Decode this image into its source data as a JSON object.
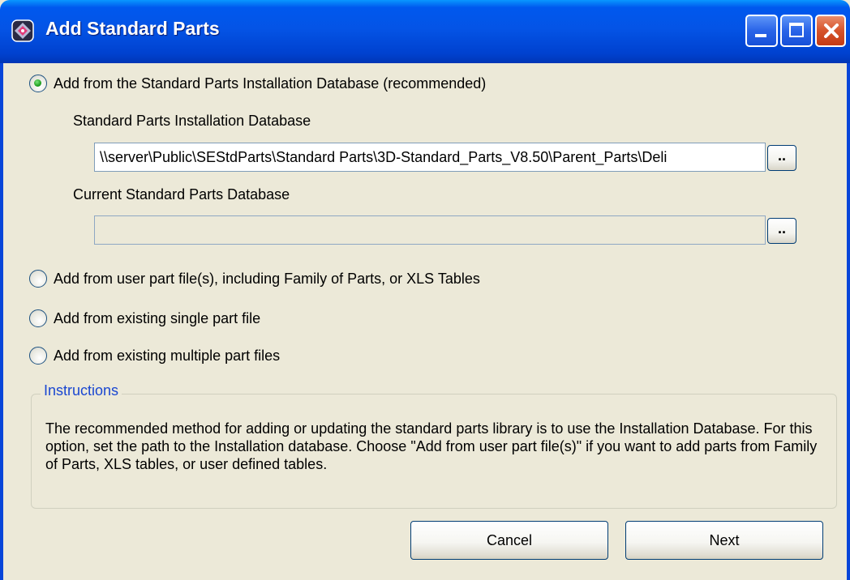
{
  "window": {
    "title": "Add Standard Parts",
    "titlebar_color": "#0054e3",
    "controls": [
      "minimize-icon",
      "maximize-icon",
      "close-icon"
    ]
  },
  "options": [
    {
      "label": "Add from the Standard Parts Installation Database (recommended)",
      "selected": true
    },
    {
      "label": "Add from user part file(s), including Family of Parts, or XLS Tables",
      "selected": false
    },
    {
      "label": "Add from existing single part file",
      "selected": false
    },
    {
      "label": "Add from existing multiple part files",
      "selected": false
    }
  ],
  "installation_db": {
    "label": "Standard Parts Installation Database",
    "value": "\\\\server\\Public\\SEStdParts\\Standard Parts\\3D-Standard_Parts_V8.50\\Parent_Parts\\Deli",
    "browse_label": ".."
  },
  "current_db": {
    "label": "Current Standard Parts Database",
    "value": "",
    "browse_label": ".."
  },
  "instructions": {
    "title": "Instructions",
    "text": "The recommended method for adding or updating the standard parts library is to use the Installation Database. For this option, set the path to the Installation database. Choose \"Add from user part file(s)\" if you want to add parts from Family of Parts, XLS tables, or user defined tables."
  },
  "buttons": {
    "cancel": "Cancel",
    "next": "Next"
  },
  "colors": {
    "dialog_bg": "#ece9d8",
    "group_title": "#1a47d1",
    "radio_selected": "#21a121"
  }
}
